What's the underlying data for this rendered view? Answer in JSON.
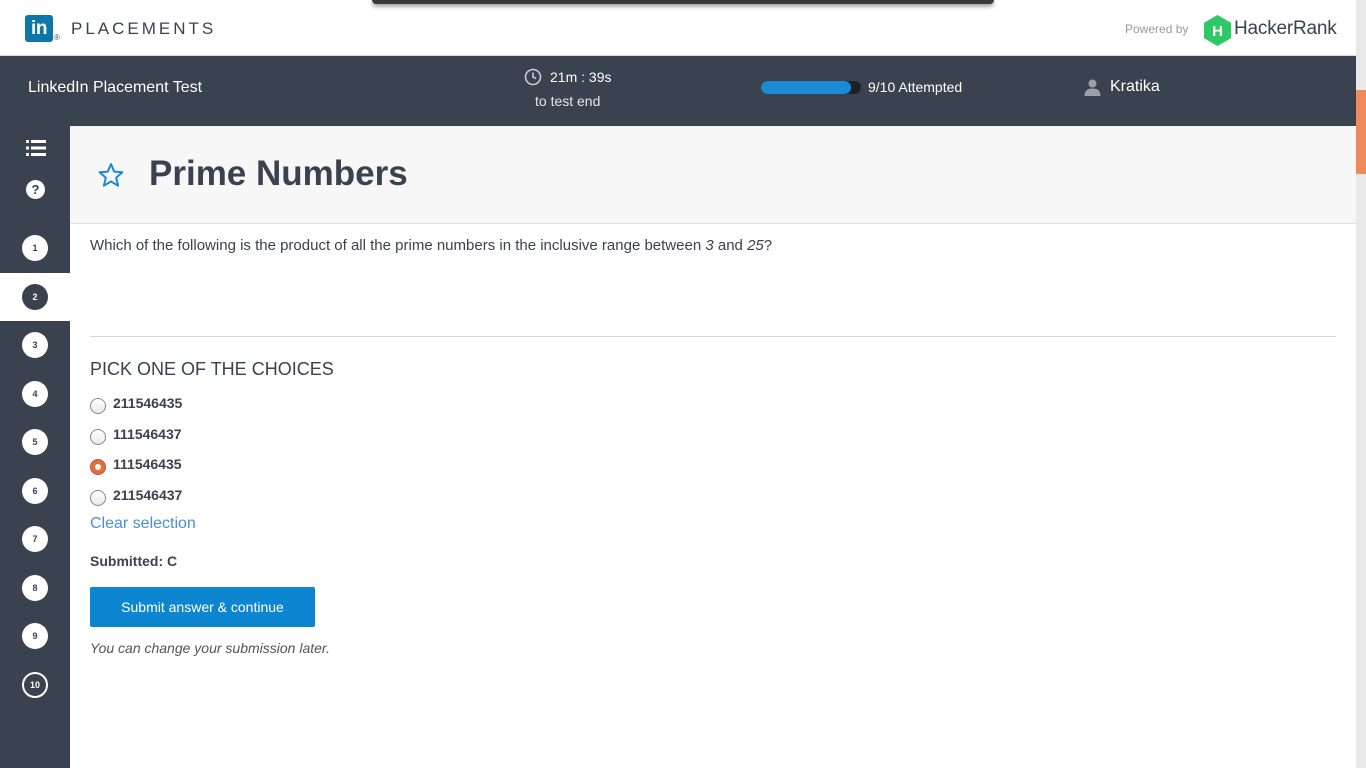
{
  "brand": {
    "logo_text": "in",
    "logo_reg": "®",
    "product": "PLACEMENTS",
    "powered_by": "Powered by",
    "partner": "HackerRank",
    "partner_mark": "H"
  },
  "header": {
    "test_title": "LinkedIn Placement Test",
    "timer": "21m : 39s",
    "timer_sub": "to test end",
    "progress": 0.9,
    "attempted": "9/10 Attempted",
    "user": "Kratika"
  },
  "sidebar": {
    "help": "?",
    "questions": [
      {
        "label": "1",
        "state": "default"
      },
      {
        "label": "2",
        "state": "active"
      },
      {
        "label": "3",
        "state": "default"
      },
      {
        "label": "4",
        "state": "default"
      },
      {
        "label": "5",
        "state": "default"
      },
      {
        "label": "6",
        "state": "default"
      },
      {
        "label": "7",
        "state": "default"
      },
      {
        "label": "8",
        "state": "default"
      },
      {
        "label": "9",
        "state": "default"
      },
      {
        "label": "10",
        "state": "open"
      }
    ]
  },
  "question": {
    "title": "Prime Numbers",
    "text_before": "Which of the following is the product of all the prime numbers in the inclusive range between ",
    "range_start": "3",
    "text_mid": " and ",
    "range_end": "25",
    "text_after": "?",
    "pick_label": "PICK ONE OF THE CHOICES",
    "choices": [
      {
        "label": "211546435",
        "selected": false
      },
      {
        "label": "111546437",
        "selected": false
      },
      {
        "label": "111546435",
        "selected": true
      },
      {
        "label": "211546437",
        "selected": false
      }
    ],
    "clear_label": "Clear selection",
    "submitted": "Submitted: C",
    "submit_label": "Submit answer & continue",
    "note": "You can change your submission later."
  },
  "colors": {
    "header_bg": "#39424e",
    "accent": "#0c86d1",
    "selected_radio": "#e2703f",
    "scroll_thumb": "#f08a5d"
  }
}
